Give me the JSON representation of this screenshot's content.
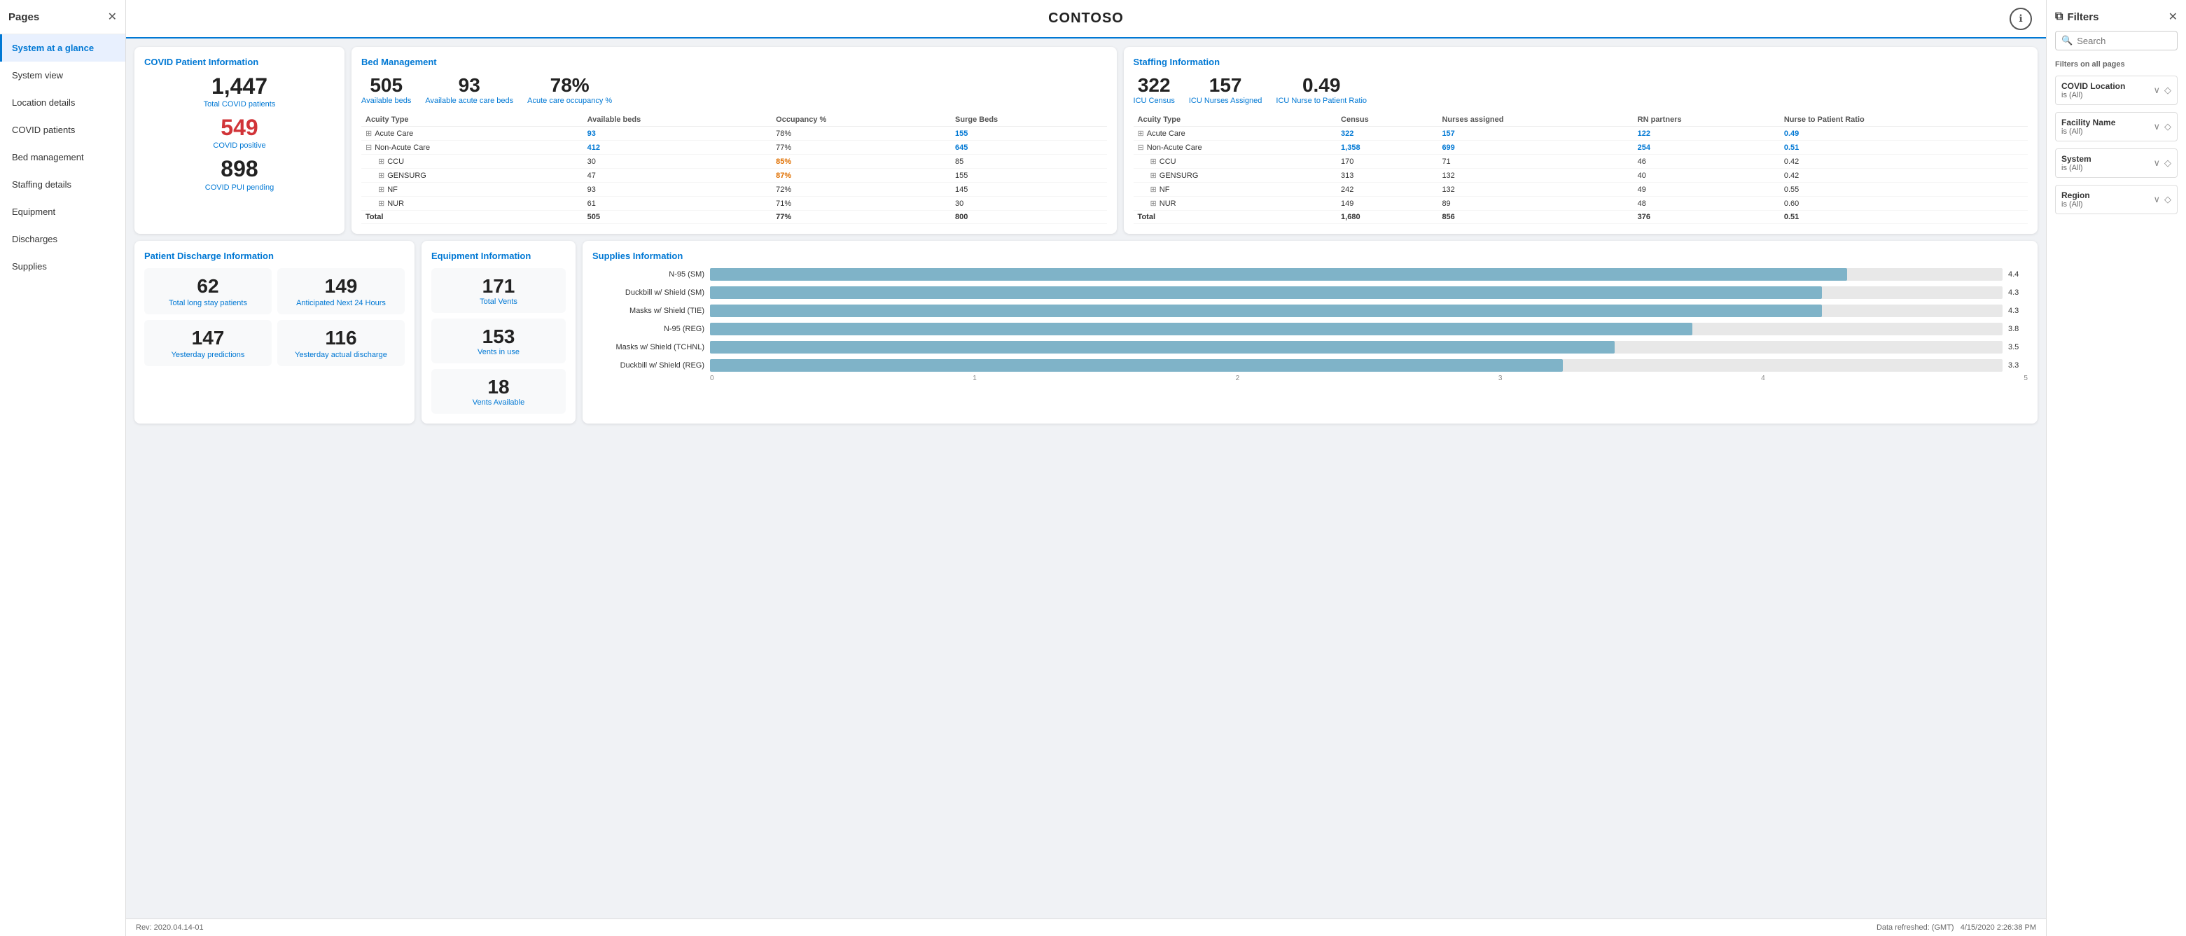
{
  "sidebar": {
    "title": "Pages",
    "items": [
      {
        "id": "system-glance",
        "label": "System at a glance",
        "active": true
      },
      {
        "id": "system-view",
        "label": "System view",
        "active": false
      },
      {
        "id": "location-details",
        "label": "Location details",
        "active": false
      },
      {
        "id": "covid-patients",
        "label": "COVID patients",
        "active": false
      },
      {
        "id": "bed-management",
        "label": "Bed management",
        "active": false
      },
      {
        "id": "staffing-details",
        "label": "Staffing details",
        "active": false
      },
      {
        "id": "equipment",
        "label": "Equipment",
        "active": false
      },
      {
        "id": "discharges",
        "label": "Discharges",
        "active": false
      },
      {
        "id": "supplies",
        "label": "Supplies",
        "active": false
      }
    ]
  },
  "header": {
    "title": "CONTOSO"
  },
  "covid": {
    "section_title": "COVID Patient Information",
    "total_covid": "1,447",
    "total_covid_label": "Total COVID patients",
    "covid_positive": "549",
    "covid_positive_label": "COVID positive",
    "covid_pui": "898",
    "covid_pui_label": "COVID PUI pending"
  },
  "bed_management": {
    "section_title": "Bed Management",
    "available_beds": "505",
    "available_beds_label": "Available beds",
    "available_acute": "93",
    "available_acute_label": "Available acute care beds",
    "acute_occupancy": "78%",
    "acute_occupancy_label": "Acute care occupancy %",
    "columns": [
      "Acuity Type",
      "Available beds",
      "Occupancy %",
      "Surge Beds"
    ],
    "rows": [
      {
        "type": "Acute Care",
        "avail": "93",
        "occ": "78%",
        "surge": "155",
        "occ_color": "normal",
        "expanded": true
      },
      {
        "type": "Non-Acute Care",
        "avail": "412",
        "occ": "77%",
        "surge": "645",
        "occ_color": "normal",
        "expanded": true
      },
      {
        "type": "CCU",
        "avail": "30",
        "occ": "85%",
        "surge": "85",
        "occ_color": "orange",
        "indent": true
      },
      {
        "type": "GENSURG",
        "avail": "47",
        "occ": "87%",
        "surge": "155",
        "occ_color": "orange",
        "indent": true
      },
      {
        "type": "NF",
        "avail": "93",
        "occ": "72%",
        "surge": "145",
        "occ_color": "normal",
        "indent": true
      },
      {
        "type": "NUR",
        "avail": "61",
        "occ": "71%",
        "surge": "30",
        "occ_color": "normal",
        "indent": true
      }
    ],
    "total_row": {
      "type": "Total",
      "avail": "505",
      "occ": "77%",
      "surge": "800"
    }
  },
  "staffing": {
    "section_title": "Staffing Information",
    "icu_census": "322",
    "icu_census_label": "ICU Census",
    "icu_nurses": "157",
    "icu_nurses_label": "ICU Nurses Assigned",
    "icu_ratio": "0.49",
    "icu_ratio_label": "ICU Nurse to Patient Ratio",
    "columns": [
      "Acuity Type",
      "Census",
      "Nurses assigned",
      "RN partners",
      "Nurse to Patient Ratio"
    ],
    "rows": [
      {
        "type": "Acute Care",
        "census": "322",
        "nurses": "157",
        "rn": "122",
        "ratio": "0.49",
        "expanded": true
      },
      {
        "type": "Non-Acute Care",
        "census": "1,358",
        "nurses": "699",
        "rn": "254",
        "ratio": "0.51",
        "expanded": true
      },
      {
        "type": "CCU",
        "census": "170",
        "nurses": "71",
        "rn": "46",
        "ratio": "0.42",
        "indent": true
      },
      {
        "type": "GENSURG",
        "census": "313",
        "nurses": "132",
        "rn": "40",
        "ratio": "0.42",
        "indent": true
      },
      {
        "type": "NF",
        "census": "242",
        "nurses": "132",
        "rn": "49",
        "ratio": "0.55",
        "indent": true
      },
      {
        "type": "NUR",
        "census": "149",
        "nurses": "89",
        "rn": "48",
        "ratio": "0.60",
        "indent": true
      }
    ],
    "total_row": {
      "type": "Total",
      "census": "1,680",
      "nurses": "856",
      "rn": "376",
      "ratio": "0.51"
    }
  },
  "discharge": {
    "section_title": "Patient Discharge Information",
    "long_stay": "62",
    "long_stay_label": "Total long stay patients",
    "next_24": "149",
    "next_24_label": "Anticipated Next 24 Hours",
    "yesterday_pred": "147",
    "yesterday_pred_label": "Yesterday predictions",
    "yesterday_actual": "116",
    "yesterday_actual_label": "Yesterday actual discharge"
  },
  "equipment": {
    "section_title": "Equipment Information",
    "total_vents": "171",
    "total_vents_label": "Total Vents",
    "vents_in_use": "153",
    "vents_in_use_label": "Vents in use",
    "vents_available": "18",
    "vents_available_label": "Vents Available"
  },
  "supplies": {
    "section_title": "Supplies Information",
    "items": [
      {
        "label": "N-95 (SM)",
        "value": 4.4,
        "max": 5
      },
      {
        "label": "Duckbill w/ Shield (SM)",
        "value": 4.3,
        "max": 5
      },
      {
        "label": "Masks w/ Shield (TIE)",
        "value": 4.3,
        "max": 5
      },
      {
        "label": "N-95 (REG)",
        "value": 3.8,
        "max": 5
      },
      {
        "label": "Masks w/ Shield (TCHNL)",
        "value": 3.5,
        "max": 5
      },
      {
        "label": "Duckbill w/ Shield (REG)",
        "value": 3.3,
        "max": 5
      }
    ],
    "axis_labels": [
      "0",
      "1",
      "2",
      "3",
      "4",
      "5"
    ]
  },
  "footer": {
    "rev": "Rev: 2020.04.14-01",
    "data_refresh": "Data refreshed: (GMT)",
    "timestamp": "4/15/2020 2:26:38 PM"
  },
  "filters": {
    "title": "Filters",
    "search_placeholder": "Search",
    "section_label": "Filters on all pages",
    "items": [
      {
        "label": "COVID Location",
        "sub": "is (All)"
      },
      {
        "label": "Facility Name",
        "sub": "is (All)"
      },
      {
        "label": "System",
        "sub": "is (All)"
      },
      {
        "label": "Region",
        "sub": "is (All)"
      }
    ]
  }
}
